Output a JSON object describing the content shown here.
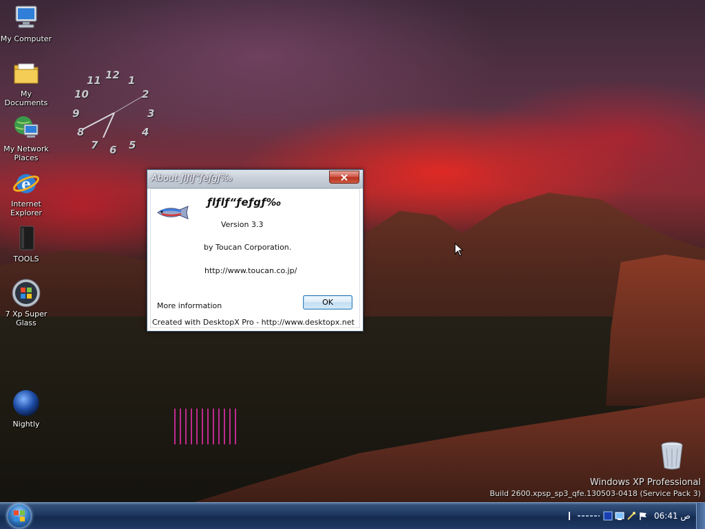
{
  "desktop_icons": [
    {
      "label": "My Computer",
      "icon": "computer-icon"
    },
    {
      "label": "My Documents",
      "icon": "folder-icon"
    },
    {
      "label": "My Network Places",
      "icon": "network-icon"
    },
    {
      "label": "Internet Explorer",
      "icon": "internet-explorer-icon"
    },
    {
      "label": "TOOLS",
      "icon": "tools-icon"
    },
    {
      "label": "7 Xp Super Glass",
      "icon": "windows-orb-icon"
    },
    {
      "label": "Nightly",
      "icon": "globe-icon"
    }
  ],
  "clock_widget": {
    "numbers": [
      "12",
      "1",
      "2",
      "3",
      "4",
      "5",
      "6",
      "7",
      "8",
      "9",
      "10",
      "11"
    ]
  },
  "dialog": {
    "title": "About ƒlƒlƒ“ƒeƒgƒ‰",
    "app_name": "ƒlƒlƒ“ƒeƒgƒ‰",
    "version": "Version 3.3",
    "company": "by Toucan Corporation.",
    "url": "http://www.toucan.co.jp/",
    "more_info": "More information",
    "ok_label": "OK",
    "footer": "Created with DesktopX Pro -  http://www.desktopx.net"
  },
  "watermark": {
    "line1": "Windows XP Professional",
    "line2": "Build 2600.xpsp_sp3_qfe.130503-0418 (Service Pack 3)"
  },
  "recycle_bin": {
    "label": "Recycle Bin"
  },
  "taskbar": {
    "clock": "06:41 ص"
  },
  "colors": {
    "taskbar": "#1d3760",
    "dialog_border": "#3d5a7a",
    "close_button": "#d1594a",
    "ok_border": "#3c7fb1"
  }
}
